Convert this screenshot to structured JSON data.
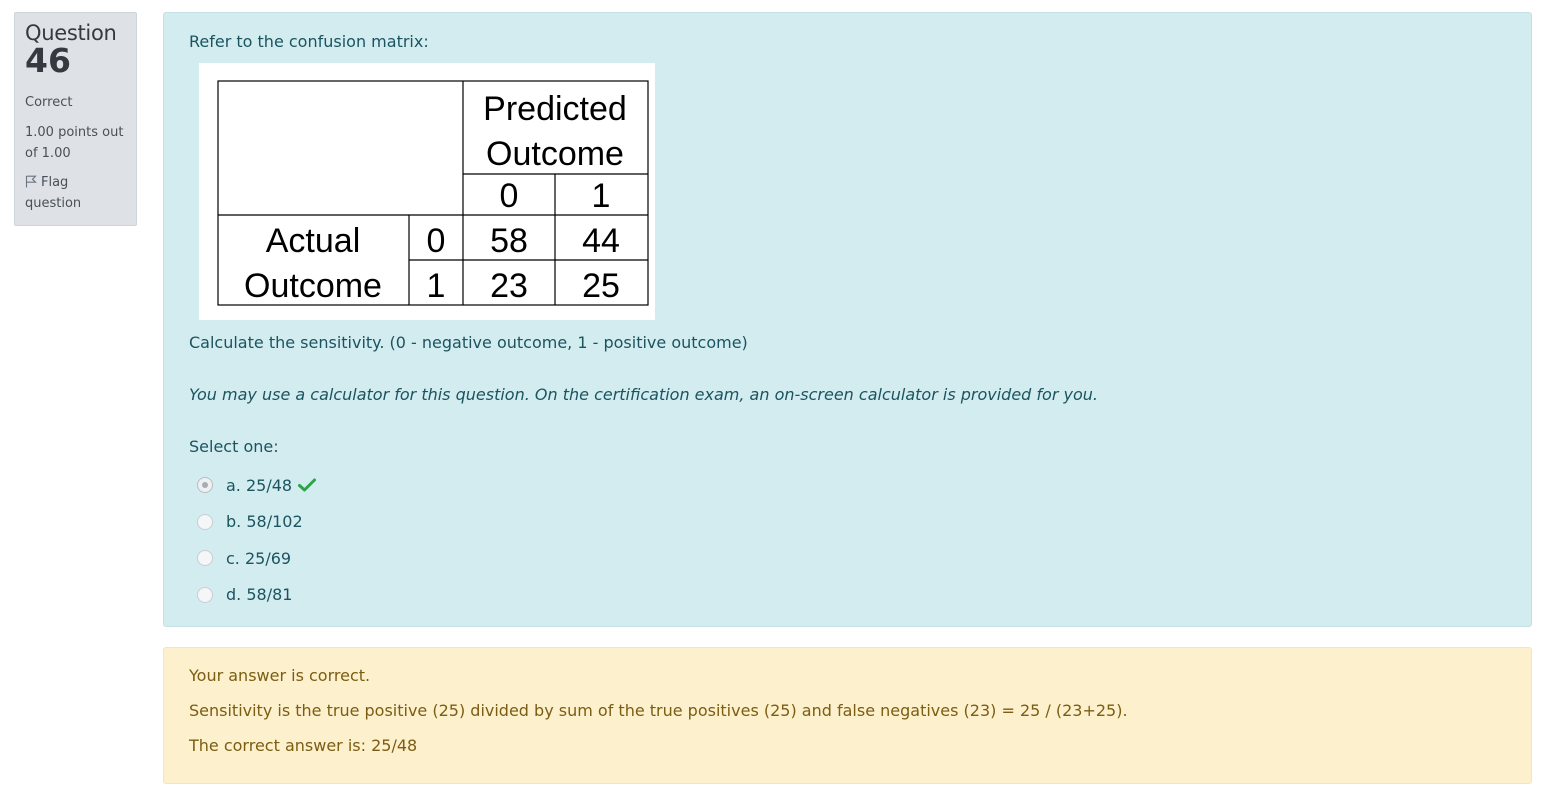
{
  "info": {
    "question_label": "Question",
    "question_number": "46",
    "state": "Correct",
    "grade_line1": "1.00 points out",
    "grade_line2": "of 1.00",
    "flag_line1": "Flag",
    "flag_line2": "question",
    "flag_icon": "flag-outline-icon"
  },
  "question": {
    "intro": "Refer to the confusion matrix:",
    "matrix": {
      "predicted_header_line1": "Predicted",
      "predicted_header_line2": "Outcome",
      "actual_header_line1": "Actual",
      "actual_header_line2": "Outcome",
      "pred_class_0": "0",
      "pred_class_1": "1",
      "actual_class_0": "0",
      "actual_class_1": "1",
      "cell_00": "58",
      "cell_01": "44",
      "cell_10": "23",
      "cell_11": "25"
    },
    "calc_text": "Calculate the sensitivity. (0 - negative outcome, 1 - positive outcome)",
    "note": "You may use a calculator for this question. On the certification exam, an on-screen calculator is provided for you.",
    "prompt": "Select one:",
    "options": [
      {
        "label": "a. 25/48",
        "selected": true,
        "correct_icon": "check-icon"
      },
      {
        "label": "b. 58/102",
        "selected": false
      },
      {
        "label": "c. 25/69",
        "selected": false
      },
      {
        "label": "d. 58/81",
        "selected": false
      }
    ]
  },
  "feedback": {
    "status": "Your answer is correct.",
    "explanation": "Sensitivity is the true positive (25) divided by sum of the true positives (25) and false negatives (23) = 25 / (23+25).",
    "right_answer": "The correct answer is: 25/48"
  },
  "colors": {
    "question_bg": "#d3ecf0",
    "question_text": "#1b545f",
    "feedback_bg": "#fdf0cc",
    "feedback_text": "#7b5d13",
    "check_green": "#28a745"
  }
}
